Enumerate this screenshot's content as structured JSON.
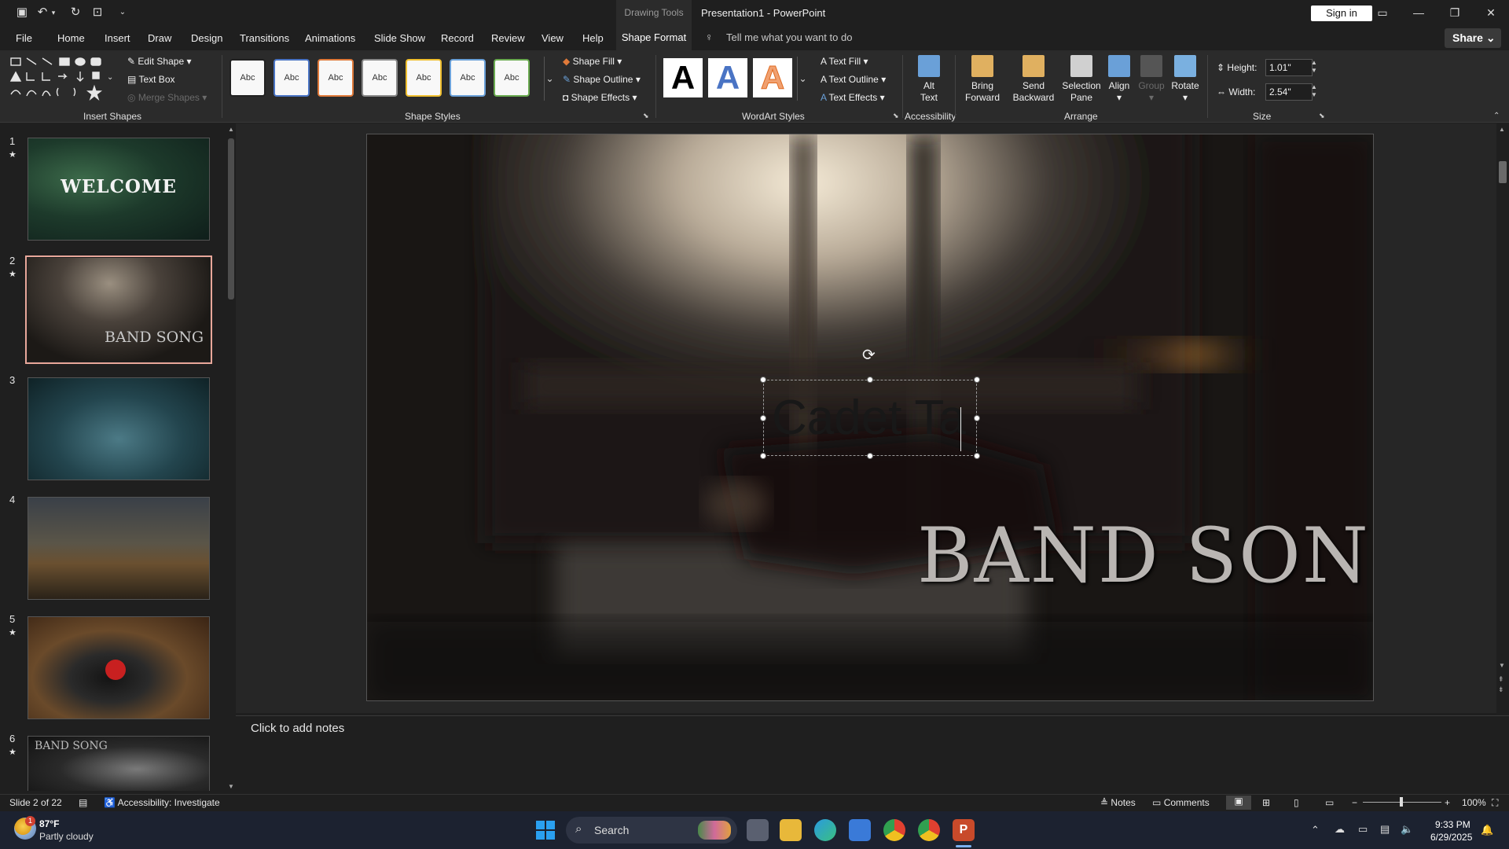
{
  "titlebar": {
    "context_label": "Drawing Tools",
    "doc_title": "Presentation1  -  PowerPoint",
    "signin_label": "Sign in",
    "minimize": "—",
    "restore": "❐",
    "close": "✕"
  },
  "tabs": [
    "File",
    "Home",
    "Insert",
    "Draw",
    "Design",
    "Transitions",
    "Animations",
    "Slide Show",
    "Record",
    "Review",
    "View",
    "Help"
  ],
  "active_tab": "Shape Format",
  "tellme_placeholder": "Tell me what you want to do",
  "share_label": "Share",
  "ribbon": {
    "insert_shapes": {
      "label": "Insert Shapes",
      "edit_shape": "Edit Shape",
      "text_box": "Text Box",
      "merge_shapes": "Merge Shapes"
    },
    "shape_styles": {
      "label": "Shape Styles",
      "swatch_text": "Abc",
      "swatch_colors": [
        "#222222",
        "#4a74c4",
        "#e07a3a",
        "#8a8a8a",
        "#f0c030",
        "#6aa0d8",
        "#6aaa50"
      ],
      "shape_fill": "Shape Fill",
      "shape_outline": "Shape Outline",
      "shape_effects": "Shape Effects"
    },
    "wordart": {
      "label": "WordArt Styles",
      "letter": "A",
      "text_fill": "Text Fill",
      "text_outline": "Text Outline",
      "text_effects": "Text Effects"
    },
    "accessibility": {
      "label": "Accessibility",
      "alt_text_1": "Alt",
      "alt_text_2": "Text"
    },
    "arrange": {
      "label": "Arrange",
      "bring_forward_1": "Bring",
      "bring_forward_2": "Forward",
      "send_backward_1": "Send",
      "send_backward_2": "Backward",
      "selection_pane_1": "Selection",
      "selection_pane_2": "Pane",
      "align": "Align",
      "group": "Group",
      "rotate": "Rotate"
    },
    "size": {
      "label": "Size",
      "height_label": "Height:",
      "height_value": "1.01\"",
      "width_label": "Width:",
      "width_value": "2.54\""
    }
  },
  "thumbnails": [
    {
      "num": "1",
      "star": "★",
      "caption": "WELCOME"
    },
    {
      "num": "2",
      "star": "★",
      "caption": "BAND SONG"
    },
    {
      "num": "3",
      "star": "",
      "caption": ""
    },
    {
      "num": "4",
      "star": "",
      "caption": ""
    },
    {
      "num": "5",
      "star": "★",
      "caption": ""
    },
    {
      "num": "6",
      "star": "★",
      "caption": "BAND SONG"
    }
  ],
  "slide": {
    "textbox_text": "Cadet Ta",
    "title_text": "BAND SONG"
  },
  "notes_placeholder": "Click to add notes",
  "statusbar": {
    "slide_count": "Slide 2 of 22",
    "accessibility": "Accessibility: Investigate",
    "notes": "Notes",
    "comments": "Comments",
    "zoom": "100%"
  },
  "taskbar": {
    "weather_temp": "87°F",
    "weather_desc": "Partly cloudy",
    "weather_badge": "1",
    "search_label": "Search",
    "time": "9:33 PM",
    "date": "6/29/2025"
  }
}
